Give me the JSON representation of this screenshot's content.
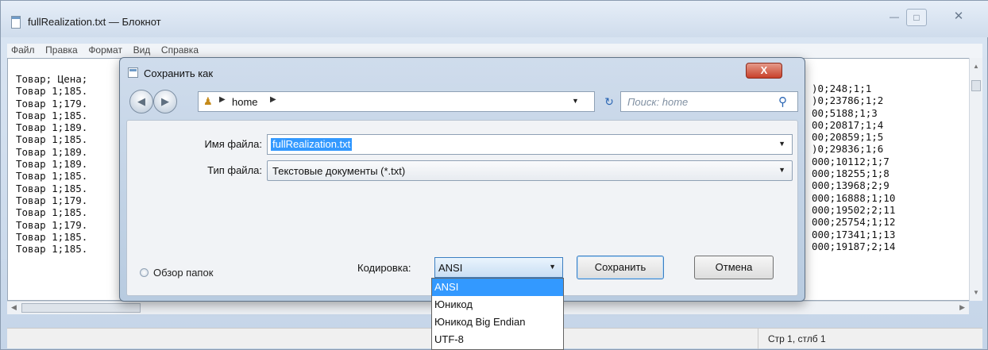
{
  "notepad": {
    "title": "fullRealization.txt — Блокнот",
    "window_controls": {
      "minimize": "—",
      "maximize": "□",
      "close": "✕"
    },
    "menu": [
      "Файл",
      "Правка",
      "Формат",
      "Вид",
      "Справка"
    ],
    "left_lines": [
      "Товар; Цена;",
      "Товар 1;185.",
      "Товар 1;179.",
      "Товар 1;185.",
      "Товар 1;189.",
      "Товар 1;185.",
      "Товар 1;189.",
      "Товар 1;189.",
      "Товар 1;185.",
      "Товар 1;185.",
      "Товар 1;179.",
      "Товар 1;185.",
      "Товар 1;179.",
      "Товар 1;185.",
      "Товар 1;185."
    ],
    "right_lines": [
      ")0;248;1;1",
      ")0;23786;1;2",
      "00;5188;1;3",
      "00;20817;1;4",
      "00;20859;1;5",
      ")0;29836;1;6",
      "000;10112;1;7",
      "000;18255;1;8",
      "000;13968;2;9",
      "000;16888;1;10",
      "000;19502;2;11",
      "000;25754;1;12",
      "000;17341;1;13",
      "000;19187;2;14"
    ],
    "status": "Стр 1, стлб 1"
  },
  "dialog": {
    "title": "Сохранить как",
    "close_label": "X",
    "address_path": "home",
    "search_placeholder": "Поиск: home",
    "filename_label": "Имя файла:",
    "filename_value": "fullRealization.txt",
    "filetype_label": "Тип файла:",
    "filetype_value": "Текстовые документы (*.txt)",
    "browse_label": "Обзор папок",
    "encoding_label": "Кодировка:",
    "encoding_value": "ANSI",
    "encoding_options": [
      "ANSI",
      "Юникод",
      "Юникод Big Endian",
      "UTF-8"
    ],
    "save_label": "Сохранить",
    "cancel_label": "Отмена"
  },
  "icons": {
    "back": "back-arrow-icon",
    "forward": "forward-arrow-icon",
    "folder": "user-folder-icon",
    "refresh": "refresh-icon",
    "search": "search-icon"
  }
}
